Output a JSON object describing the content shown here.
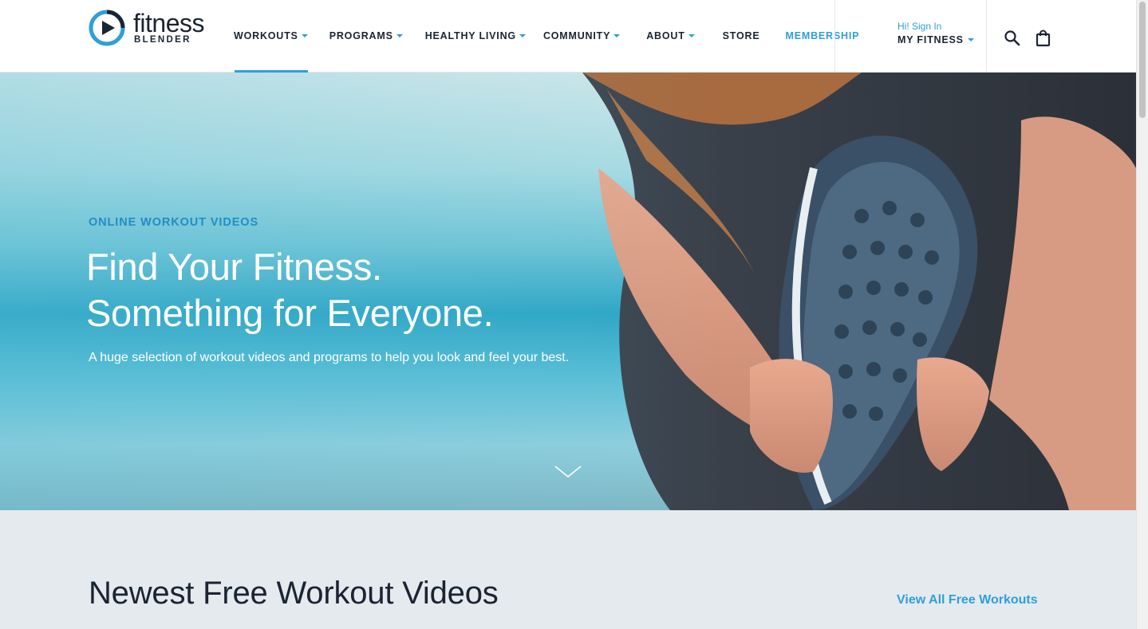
{
  "brand": {
    "name": "fitness",
    "sub": "BLENDER",
    "accent": "#2e9fd9",
    "dark": "#1b2433"
  },
  "nav": {
    "items": [
      {
        "label": "WORKOUTS",
        "dropdown": true
      },
      {
        "label": "PROGRAMS",
        "dropdown": true
      },
      {
        "label": "HEALTHY LIVING",
        "dropdown": true
      },
      {
        "label": "COMMUNITY",
        "dropdown": true
      },
      {
        "label": "ABOUT",
        "dropdown": true
      },
      {
        "label": "STORE",
        "dropdown": false
      },
      {
        "label": "MEMBERSHIP",
        "dropdown": false
      }
    ]
  },
  "account": {
    "greeting": "Hi! Sign In",
    "label": "MY FITNESS"
  },
  "icons": {
    "search": "search-icon",
    "cart": "shopping-bag-icon",
    "scroll": "chevron-down-icon"
  },
  "hero": {
    "eyebrow": "ONLINE WORKOUT VIDEOS",
    "line1": "Find Your Fitness.",
    "line2": "Something for Everyone.",
    "sub": "A huge selection of workout videos and programs to help you look and feel your best."
  },
  "section": {
    "title": "Newest Free Workout Videos",
    "link": "View All Free Workouts"
  }
}
